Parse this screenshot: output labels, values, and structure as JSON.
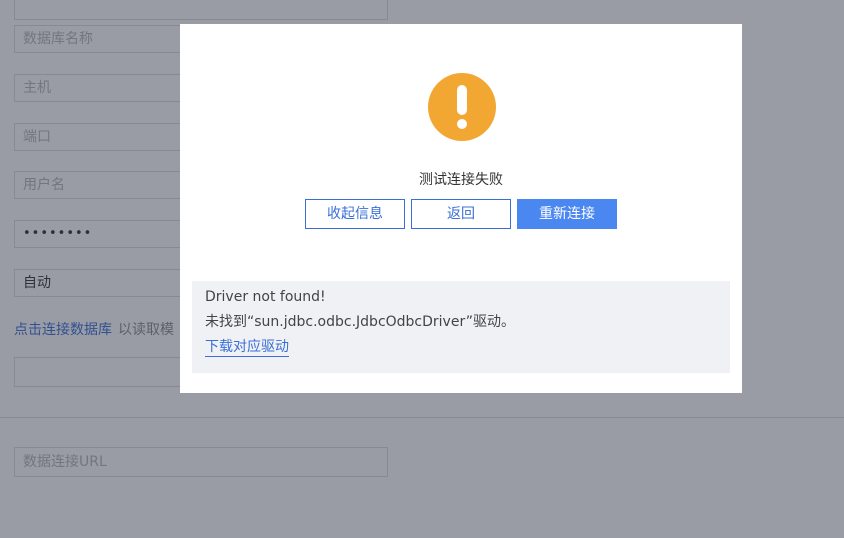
{
  "form": {
    "db_name_placeholder": "数据库名称",
    "host_placeholder": "主机",
    "port_placeholder": "端口",
    "username_placeholder": "用户名",
    "password_value": "••••••••",
    "mode_value": "自动",
    "connect_link": "点击连接数据库",
    "connect_hint": "以读取模",
    "url_placeholder": "数据连接URL"
  },
  "dialog": {
    "icon": "warning-icon",
    "icon_color": "#f3a733",
    "title": "测试连接失败",
    "buttons": {
      "collapse": "收起信息",
      "back": "返回",
      "retry": "重新连接"
    },
    "detail": {
      "error": "Driver not found!",
      "message": "未找到“sun.jdbc.odbc.JdbcOdbcDriver”驱动。",
      "download_link": "下载对应驱动"
    }
  },
  "colors": {
    "accent": "#4a87f0",
    "link": "#3a6fd8"
  }
}
